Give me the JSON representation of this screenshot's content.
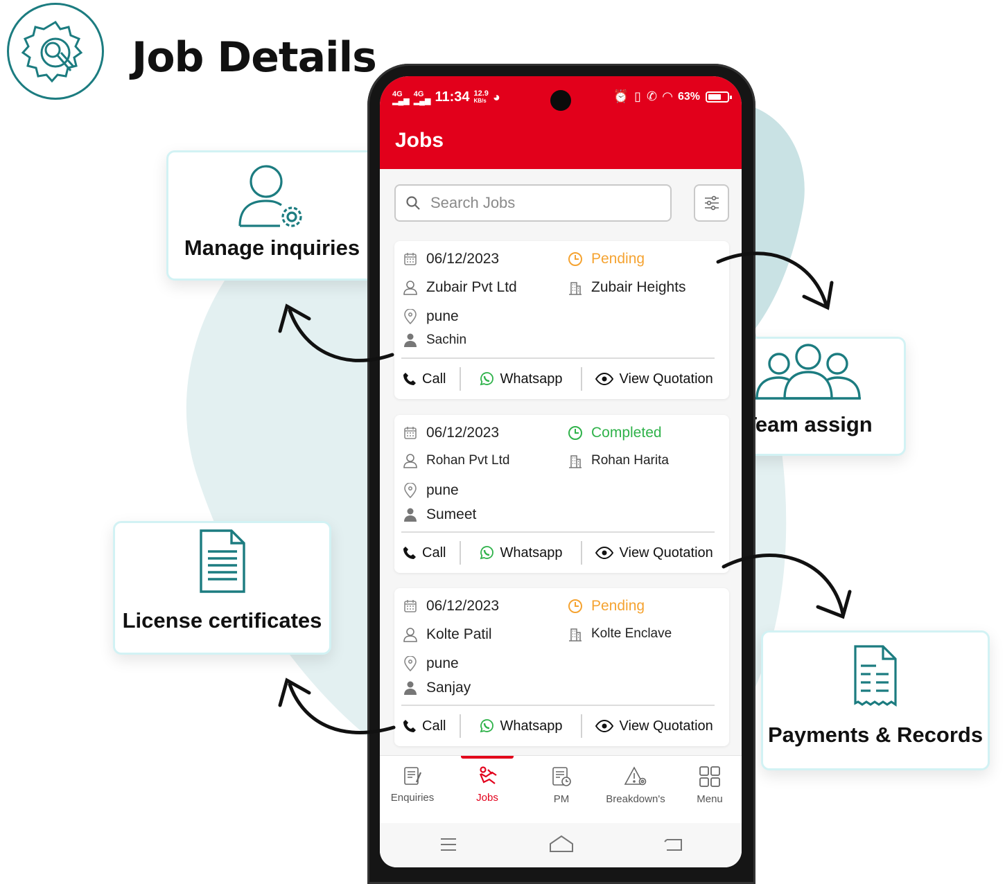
{
  "page": {
    "title": "Job Details"
  },
  "features": {
    "manage_inquiries": "Manage inquiries",
    "team_assign": "Team assign",
    "license_certificates": "License certificates",
    "payments_records": "Payments & Records"
  },
  "statusbar": {
    "network": "4G",
    "time": "11:34",
    "speed": "12.9",
    "speed_unit": "KB/s",
    "battery": "63%"
  },
  "app": {
    "title": "Jobs"
  },
  "search": {
    "placeholder": "Search Jobs"
  },
  "jobs": [
    {
      "date": "06/12/2023",
      "status": "Pending",
      "client": "Zubair Pvt Ltd",
      "site": "Zubair Heights",
      "location": "pune",
      "engineer": "Sachin"
    },
    {
      "date": "06/12/2023",
      "status": "Completed",
      "client": "Rohan Pvt Ltd",
      "site": "Rohan Harita",
      "location": "pune",
      "engineer": "Sumeet"
    },
    {
      "date": "06/12/2023",
      "status": "Pending",
      "client": "Kolte Patil",
      "site": "Kolte Enclave",
      "location": "pune",
      "engineer": "Sanjay"
    }
  ],
  "actions": {
    "call": "Call",
    "whatsapp": "Whatsapp",
    "view_quotation": "View Quotation"
  },
  "bottom_nav": [
    {
      "label": "Enquiries",
      "icon": "enquiries-icon",
      "active": false
    },
    {
      "label": "Jobs",
      "icon": "jobs-icon",
      "active": true
    },
    {
      "label": "PM",
      "icon": "pm-icon",
      "active": false
    },
    {
      "label": "Breakdown's",
      "icon": "breakdown-icon",
      "active": false
    },
    {
      "label": "Menu",
      "icon": "menu-grid-icon",
      "active": false
    }
  ],
  "colors": {
    "brand_red": "#e2001b",
    "teal": "#1c7c80",
    "pending": "#f5a331",
    "completed": "#2fb24a"
  }
}
